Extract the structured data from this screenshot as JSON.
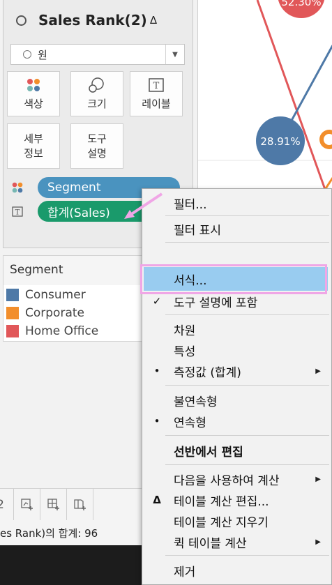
{
  "marks": {
    "title": "Sales Rank(2)",
    "title_icon": "delta-icon",
    "mark_type": "원",
    "buttons": {
      "color": "색상",
      "size": "크기",
      "label": "레이블",
      "detail": "세부\n정보",
      "tooltip": "도구\n설명"
    },
    "pills": [
      {
        "label": "Segment",
        "icon": "color-dots-icon",
        "color": "#4a93bf"
      },
      {
        "label": "합계(Sales)",
        "icon": "label-t-icon",
        "color": "#1a9a6b"
      }
    ]
  },
  "legend": {
    "title": "Segment",
    "items": [
      {
        "label": "Consumer",
        "color": "#4e79a7"
      },
      {
        "label": "Corporate",
        "color": "#f28e2b"
      },
      {
        "label": "Home Office",
        "color": "#e15759"
      }
    ]
  },
  "toolbar": {
    "page_number": "2"
  },
  "status_bar": {
    "text": "es Rank)의 합계: 96"
  },
  "chart": {
    "labels": [
      "52.30%",
      "28.91%"
    ],
    "colors": {
      "consumer": "#4e79a7",
      "corporate": "#f28e2b",
      "home_office": "#e15759"
    }
  },
  "context_menu": {
    "items": [
      {
        "label": "필터...",
        "mark": "",
        "submenu": false,
        "bold": false
      },
      {
        "label": "필터 표시",
        "mark": "",
        "submenu": false,
        "bold": false
      },
      {
        "label": "서식...",
        "mark": "",
        "submenu": false,
        "bold": false,
        "highlighted": true
      },
      {
        "label": "도구 설명에 포함",
        "mark": "✓",
        "submenu": false,
        "bold": false
      },
      {
        "label": "차원",
        "mark": "",
        "submenu": false,
        "bold": false
      },
      {
        "label": "특성",
        "mark": "",
        "submenu": false,
        "bold": false
      },
      {
        "label": "측정값 (합계)",
        "mark": "•",
        "submenu": true,
        "bold": false
      },
      {
        "label": "불연속형",
        "mark": "",
        "submenu": false,
        "bold": false
      },
      {
        "label": "연속형",
        "mark": "•",
        "submenu": false,
        "bold": false
      },
      {
        "label": "선반에서 편집",
        "mark": "",
        "submenu": false,
        "bold": true
      },
      {
        "label": "다음을 사용하여 계산",
        "mark": "",
        "submenu": true,
        "bold": false
      },
      {
        "label": "테이블 계산 편집...",
        "mark": "Δ",
        "submenu": false,
        "bold": false
      },
      {
        "label": "테이블 계산 지우기",
        "mark": "",
        "submenu": false,
        "bold": false
      },
      {
        "label": "퀵 테이블 계산",
        "mark": "",
        "submenu": true,
        "bold": false
      },
      {
        "label": "제거",
        "mark": "",
        "submenu": false,
        "bold": false
      }
    ]
  },
  "annotation": {
    "arrow_color": "#f0a6e6",
    "frame_color": "#f0a6e6"
  }
}
